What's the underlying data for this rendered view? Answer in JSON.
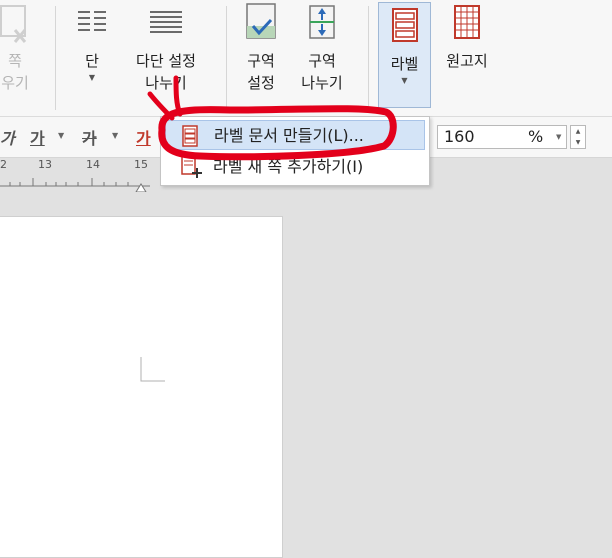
{
  "ribbon": {
    "page_num_btn": "쪽\n우기",
    "column_btn": "단",
    "multi_column_btn": "다단 설정\n나누기",
    "section_setup_btn": "구역\n설정",
    "section_split_btn": "구역\n나누기",
    "label_btn": "라벨",
    "manuscript_btn": "원고지"
  },
  "format_bar": {
    "char1": "가",
    "char2": "가",
    "char3": "가",
    "char4": "가",
    "zoom_value": "160",
    "zoom_unit": "%"
  },
  "ruler": {
    "ticks": [
      "2",
      "13",
      "14",
      "15"
    ]
  },
  "menu": {
    "items": [
      {
        "label": "라벨 문서 만들기(L)...",
        "icon": "label-doc-icon"
      },
      {
        "label": "라벨 새 쪽 추가하기(I)",
        "icon": "label-add-page-icon"
      }
    ]
  },
  "colors": {
    "highlight": "#d4e4f7",
    "annotation": "#e3001b",
    "icon_red": "#c0392b"
  }
}
